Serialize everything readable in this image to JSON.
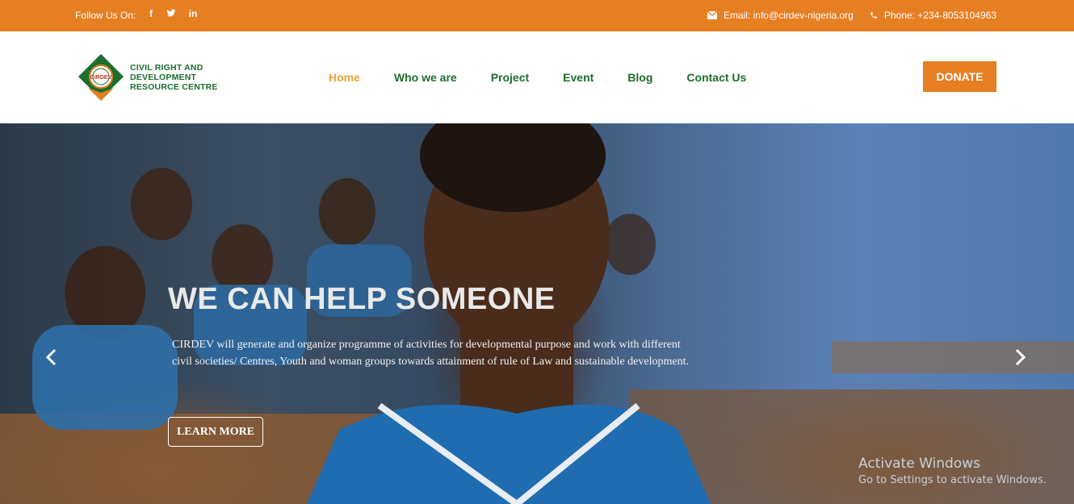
{
  "topbar": {
    "follow_label": "Follow Us On:",
    "socials": [
      {
        "icon": "facebook-icon",
        "glyph": "f"
      },
      {
        "icon": "twitter-icon",
        "glyph": "t"
      },
      {
        "icon": "linkedin-icon",
        "glyph": "in"
      }
    ],
    "email_label": "Email: info@cirdev-nigeria.org",
    "phone_label": "Phone: +234-8053104963"
  },
  "logo": {
    "badge_text": "CIRDEV",
    "line1": "CIVIL RIGHT AND",
    "line2": "DEVELOPMENT",
    "line3": "RESOURCE CENTRE"
  },
  "nav": {
    "items": [
      "Home",
      "Who we are",
      "Project",
      "Event",
      "Blog",
      "Contact Us"
    ],
    "active_index": 0
  },
  "donate_label": "DONATE",
  "hero": {
    "title": "WE CAN HELP SOMEONE",
    "description": "CIRDEV will generate and organize programme of activities for developmental purpose and work with different civil societies/ Centres, Youth and woman groups towards attainment of rule of Law and sustainable development.",
    "button_label": "LEARN MORE"
  },
  "watermark": {
    "line1": "Activate Windows",
    "line2": "Go to Settings to activate Windows."
  },
  "colors": {
    "accent": "#e67e22",
    "nav_green": "#1b6e2c",
    "nav_active": "#e8a33a"
  }
}
